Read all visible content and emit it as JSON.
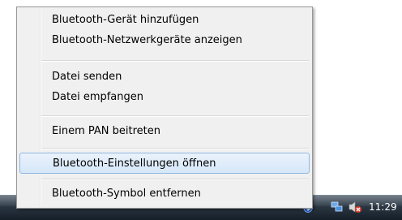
{
  "menu": {
    "items": [
      {
        "label": "Bluetooth-Gerät hinzufügen"
      },
      {
        "label": "Bluetooth-Netzwerkgeräte anzeigen"
      },
      {
        "label": "Datei senden"
      },
      {
        "label": "Datei empfangen"
      },
      {
        "label": "Einem PAN beitreten"
      },
      {
        "label": "Bluetooth-Einstellungen öffnen"
      },
      {
        "label": "Bluetooth-Symbol entfernen"
      }
    ],
    "highlighted_index": 5
  },
  "taskbar": {
    "language": "DE",
    "clock": "11:29",
    "tray_icons": [
      "chevron-left-icon",
      "bluetooth-icon",
      "network-icon",
      "volume-muted-icon"
    ]
  },
  "colors": {
    "menu_background": "#f0f0f0",
    "highlight_border": "#8fb7e0",
    "taskbar": "#1f2a34"
  }
}
